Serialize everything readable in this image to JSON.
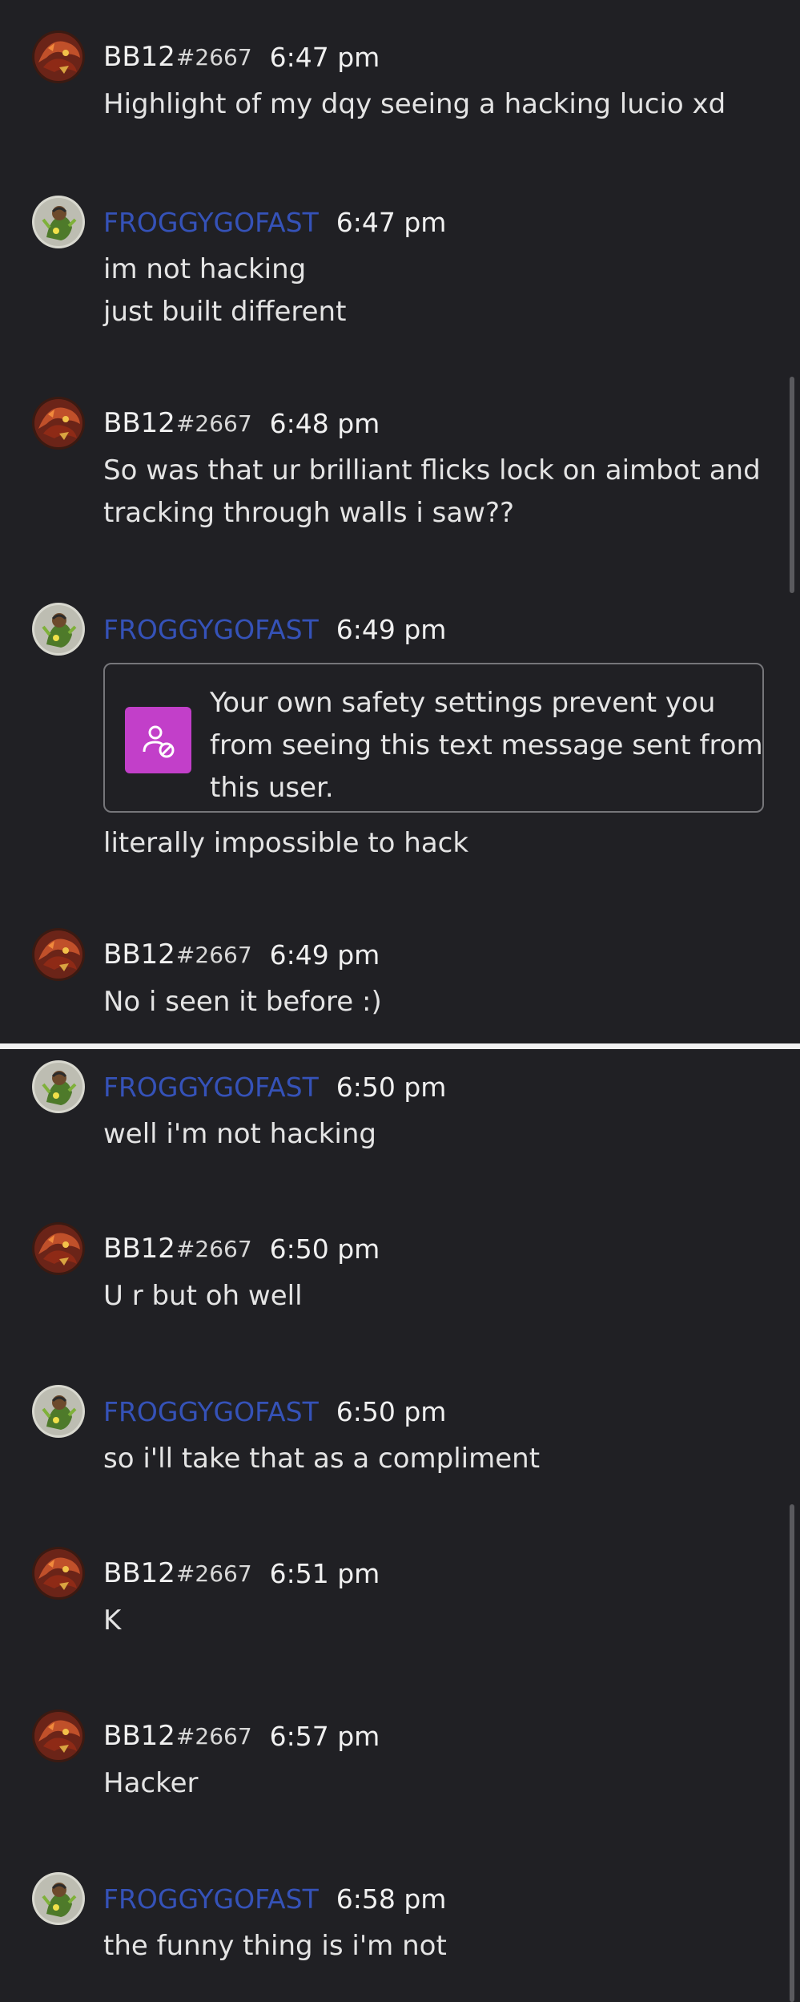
{
  "users": {
    "bb12": {
      "name": "BB12",
      "tag": "#2667"
    },
    "froggy": {
      "name": "FROGGYGOFAST"
    }
  },
  "colors": {
    "background": "#202024",
    "froggy_name": "#3552b8",
    "blocked_icon_bg": "#c23fc9",
    "divider": "#f2f2f2"
  },
  "top_messages": [
    {
      "time": "6:47 pm",
      "lines": [
        "Highlight of my dqy seeing a hacking lucio xd"
      ]
    },
    {
      "time": "6:47 pm",
      "lines": [
        "im not hacking",
        "just built different"
      ]
    },
    {
      "time": "6:48 pm",
      "lines": [
        "So was that ur brilliant flicks lock on aimbot and",
        "tracking through walls i saw??"
      ]
    },
    {
      "time": "6:49 pm",
      "lines": []
    },
    {
      "time": "6:49 pm",
      "lines": [
        "No i seen it before :)"
      ]
    }
  ],
  "blocked_notice": {
    "icon": "blocked-user-icon",
    "lines": [
      "Your own safety settings prevent you",
      "from seeing this text message sent from",
      "this user."
    ],
    "after_line": "literally impossible to hack"
  },
  "bottom_messages": [
    {
      "time": "6:50 pm",
      "lines": [
        "well i'm not hacking"
      ]
    },
    {
      "time": "6:50 pm",
      "lines": [
        "U r but oh well"
      ]
    },
    {
      "time": "6:50 pm",
      "lines": [
        "so i'll take that as a compliment"
      ]
    },
    {
      "time": "6:51 pm",
      "lines": [
        "K"
      ]
    },
    {
      "time": "6:57 pm",
      "lines": [
        "Hacker"
      ]
    },
    {
      "time": "6:58 pm",
      "lines": [
        "the funny thing is i'm not"
      ]
    }
  ]
}
